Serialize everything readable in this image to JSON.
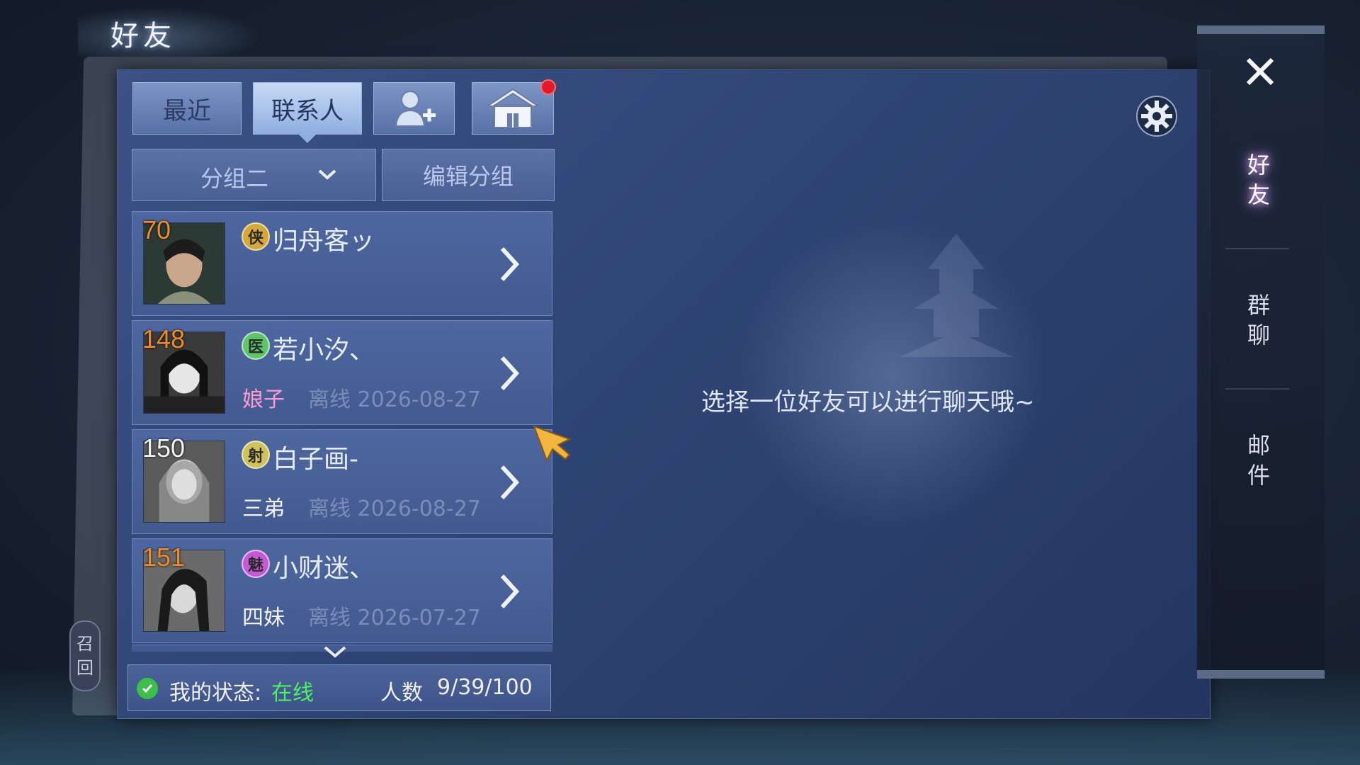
{
  "window": {
    "title": "好友"
  },
  "tabs": [
    {
      "label": "最近",
      "active": false
    },
    {
      "label": "联系人",
      "active": true
    },
    {
      "icon": "add-friend-icon"
    },
    {
      "icon": "home-icon",
      "notification": true
    }
  ],
  "group": {
    "selected": "分组二",
    "edit_label": "编辑分组"
  },
  "friends": [
    {
      "level": "70",
      "school": "侠",
      "name": "归舟客ッ",
      "relation": "",
      "status": ""
    },
    {
      "level": "148",
      "school": "医",
      "name": "若小汐、",
      "relation": "娘子",
      "status": "离线 2026-08-27"
    },
    {
      "level": "150",
      "school": "射",
      "name": "白子画-",
      "relation": "三弟",
      "status": "离线 2026-08-27"
    },
    {
      "level": "151",
      "school": "魅",
      "name": "小财迷、",
      "relation": "四妹",
      "status": "离线 2026-07-27"
    }
  ],
  "footer": {
    "status_label": "我的状态:",
    "status_value": "在线",
    "count_label": "人数",
    "count_value": "9/39/100"
  },
  "chat": {
    "empty_prompt": "选择一位好友可以进行聊天哦~"
  },
  "right_nav": {
    "items": [
      {
        "label": "好\n友",
        "active": true
      },
      {
        "label": "群\n聊",
        "active": false
      },
      {
        "label": "邮\n件",
        "active": false
      }
    ]
  },
  "recall": {
    "label": "召\n回"
  },
  "colors": {
    "online": "#4ef063",
    "level": "#f08a2a",
    "relation_pink": "#ff9ad1",
    "notification": "#e11b2b"
  }
}
